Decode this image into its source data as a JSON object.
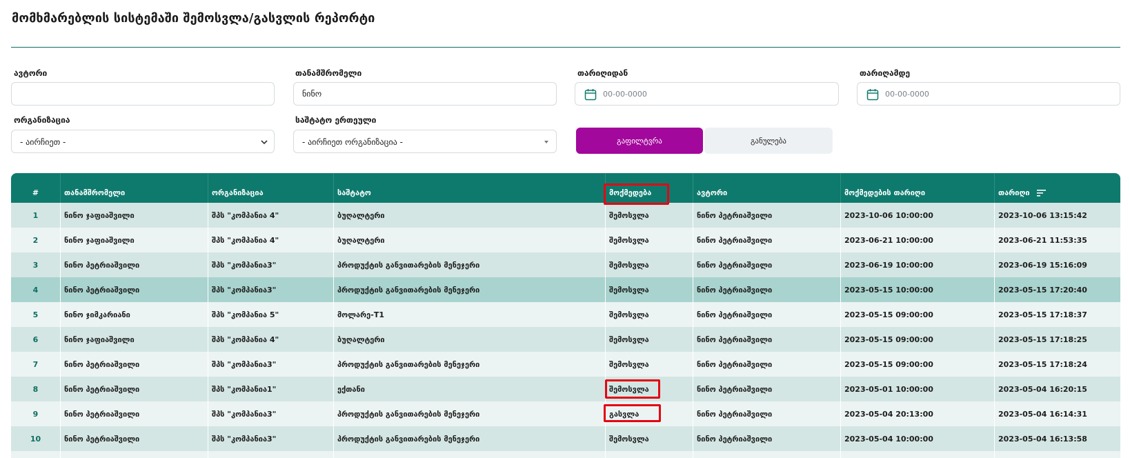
{
  "page": {
    "title": "მომხმარებლის სისტემაში შემოსვლა/გასვლის რეპორტი"
  },
  "filters": {
    "author": {
      "label": "ავტორი",
      "value": ""
    },
    "employee": {
      "label": "თანამშრომელი",
      "value": "ნინო"
    },
    "date_from": {
      "label": "თარიღიდან",
      "placeholder": "00-00-0000",
      "icon": "calendar-icon"
    },
    "date_to": {
      "label": "თარიღამდე",
      "placeholder": "00-00-0000",
      "icon": "calendar-icon"
    },
    "organization": {
      "label": "ორგანიზაცია",
      "selected": "- აირჩიეთ -"
    },
    "staff_unit": {
      "label": "საშტატო ერთეული",
      "selected": "- აირჩიეთ ორგანიზაცია -"
    },
    "filter_button": "გაფილტვრა",
    "clear_button": "განულება"
  },
  "table": {
    "columns": [
      "#",
      "თანამშრომელი",
      "ორგანიზაცია",
      "საშტატო",
      "მოქმედება",
      "ავტორი",
      "მოქმედების თარიღი",
      "თარიღი"
    ],
    "rows": [
      [
        "1",
        "ნინო ჯაფიაშვილი",
        "შპს \"კომპანია 4\"",
        "ბუღალტერი",
        "შემოსვლა",
        "ნინო პეტრიაშვილი",
        "2023-10-06 10:00:00",
        "2023-10-06 13:15:42"
      ],
      [
        "2",
        "ნინო ჯაფიაშვილი",
        "შპს \"კომპანია 4\"",
        "ბუღალტერი",
        "შემოსვლა",
        "ნინო პეტრიაშვილი",
        "2023-06-21 10:00:00",
        "2023-06-21 11:53:35"
      ],
      [
        "3",
        "ნინო პეტრიაშვილი",
        "შპს \"კომპანია3\"",
        "პროდუქტის განვითარების მენეჯერი",
        "შემოსვლა",
        "ნინო პეტრიაშვილი",
        "2023-06-19 10:00:00",
        "2023-06-19 15:16:09"
      ],
      [
        "4",
        "ნინო პეტრიაშვილი",
        "შპს \"კომპანია3\"",
        "პროდუქტის განვითარების მენეჯერი",
        "შემოსვლა",
        "ნინო პეტრიაშვილი",
        "2023-05-15 10:00:00",
        "2023-05-15 17:20:40"
      ],
      [
        "5",
        "ნინო ჯიმკარიანი",
        "შპს \"კომპანია 5\"",
        "მოლარე-T1",
        "შემოსვლა",
        "ნინო პეტრიაშვილი",
        "2023-05-15 09:00:00",
        "2023-05-15 17:18:37"
      ],
      [
        "6",
        "ნინო ჯაფიაშვილი",
        "შპს \"კომპანია 4\"",
        "ბუღალტერი",
        "შემოსვლა",
        "ნინო პეტრიაშვილი",
        "2023-05-15 09:00:00",
        "2023-05-15 17:18:25"
      ],
      [
        "7",
        "ნინო პეტრიაშვილი",
        "შპს \"კომპანია3\"",
        "პროდუქტის განვითარების მენეჯერი",
        "შემოსვლა",
        "ნინო პეტრიაშვილი",
        "2023-05-15 09:00:00",
        "2023-05-15 17:18:24"
      ],
      [
        "8",
        "ნინო პეტრიაშვილი",
        "შპს \"კომპანია1\"",
        "ექთანი",
        "შემოსვლა",
        "ნინო პეტრიაშვილი",
        "2023-05-01 10:00:00",
        "2023-05-04 16:20:15"
      ],
      [
        "9",
        "ნინო პეტრიაშვილი",
        "შპს \"კომპანია3\"",
        "პროდუქტის განვითარების მენეჯერი",
        "გასვლა",
        "ნინო პეტრიაშვილი",
        "2023-05-04 20:13:00",
        "2023-05-04 16:14:31"
      ],
      [
        "10",
        "ნინო პეტრიაშვილი",
        "შპს \"კომპანია3\"",
        "პროდუქტის განვითარების მენეჯერი",
        "შემოსვლა",
        "ნინო პეტრიაშვილი",
        "2023-05-04 10:00:00",
        "2023-05-04 16:13:58"
      ]
    ],
    "sort_icon": "sort-descending-icon",
    "hovered_row": 4
  },
  "colors": {
    "header_bg": "#0e7a6d",
    "accent_rule": "#0e6e63",
    "filter_button": "#a3089c",
    "highlight": "#e30613"
  }
}
